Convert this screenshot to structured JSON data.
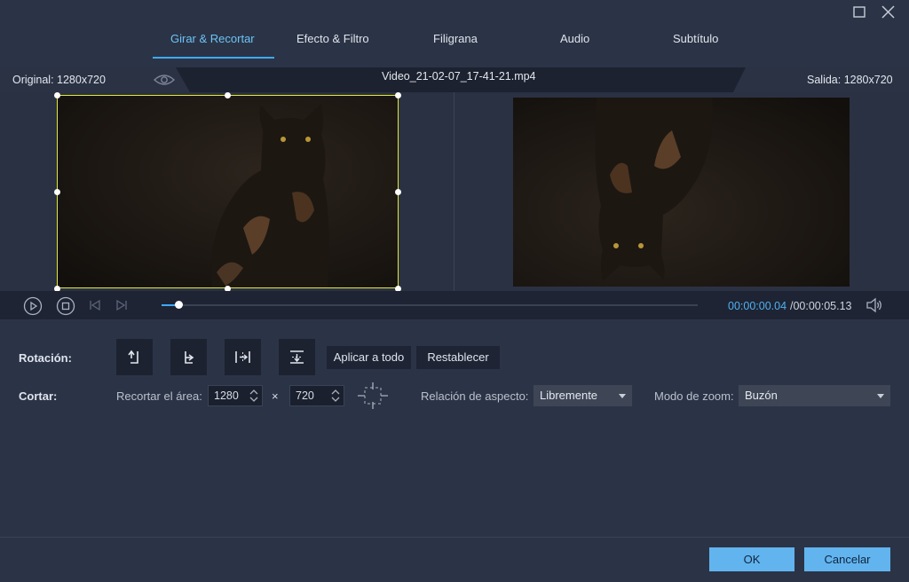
{
  "window": {
    "maximize_icon": "maximize-icon",
    "close_icon": "close-icon"
  },
  "tabs": [
    {
      "label": "Girar & Recortar",
      "active": true
    },
    {
      "label": "Efecto & Filtro"
    },
    {
      "label": "Filigrana"
    },
    {
      "label": "Audio"
    },
    {
      "label": "Subtítulo"
    }
  ],
  "info": {
    "original": "Original: 1280x720",
    "filename": "Video_21-02-07_17-41-21.mp4",
    "output": "Salida: 1280x720"
  },
  "player": {
    "current_time": "00:00:00.04",
    "total_time": "/00:00:05.13",
    "progress": 0.032
  },
  "rotation": {
    "label": "Rotación:",
    "buttons": [
      "rotate-left-icon",
      "rotate-right-icon",
      "flip-horizontal-icon",
      "flip-vertical-icon"
    ],
    "apply_all": "Aplicar a todo",
    "reset": "Restablecer"
  },
  "crop": {
    "label": "Cortar:",
    "area_label": "Recortar el área:",
    "width": "1280",
    "times": "×",
    "height": "720",
    "aspect_label": "Relación de aspecto:",
    "aspect_value": "Libremente",
    "zoom_label": "Modo de zoom:",
    "zoom_value": "Buzón"
  },
  "footer": {
    "ok": "OK",
    "cancel": "Cancelar"
  },
  "colors": {
    "accent": "#3fa9f5",
    "crop_frame": "#e4ea35",
    "button": "#62b4ef"
  }
}
